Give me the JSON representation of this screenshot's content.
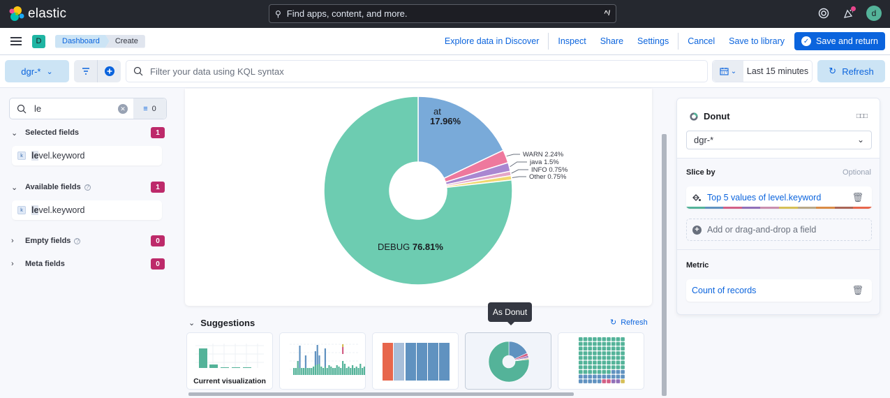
{
  "topbar": {
    "brand": "elastic",
    "search_placeholder": "Find apps, content, and more.",
    "search_shortcut": "^/",
    "avatar_initial": "d",
    "icons": [
      "help-icon",
      "news-icon",
      "user-avatar"
    ]
  },
  "header": {
    "space_initial": "D",
    "breadcrumbs": [
      "Dashboard",
      "Create"
    ],
    "links": [
      "Explore data in Discover",
      "Inspect",
      "Share",
      "Settings",
      "Cancel",
      "Save to library"
    ],
    "primary_button": "Save and return"
  },
  "query_bar": {
    "data_view": "dgr-*",
    "kql_placeholder": "Filter your data using KQL syntax",
    "time_range": "Last 15 minutes",
    "refresh_label": "Refresh"
  },
  "field_list": {
    "search_value": "le",
    "filter_count": "0",
    "sections": [
      {
        "label": "Selected fields",
        "count": "1",
        "expanded": true,
        "help": false,
        "fields": [
          {
            "type": "k",
            "match": "le",
            "rest": "vel.keyword"
          }
        ]
      },
      {
        "label": "Available fields",
        "count": "1",
        "expanded": true,
        "help": true,
        "fields": [
          {
            "type": "k",
            "match": "le",
            "rest": "vel.keyword"
          }
        ]
      },
      {
        "label": "Empty fields",
        "count": "0",
        "expanded": false,
        "help": true,
        "fields": []
      },
      {
        "label": "Meta fields",
        "count": "0",
        "expanded": false,
        "help": false,
        "fields": []
      }
    ]
  },
  "chart_data": {
    "type": "pie",
    "donut": true,
    "title": "",
    "slices": [
      {
        "label": "at",
        "value": 17.96,
        "color": "#79aad9"
      },
      {
        "label": "WARN",
        "value": 2.24,
        "color": "#ee789d"
      },
      {
        "label": "java",
        "value": 1.5,
        "color": "#a987d1"
      },
      {
        "label": "INFO",
        "value": 0.75,
        "color": "#e4a6c7"
      },
      {
        "label": "Other",
        "value": 0.75,
        "color": "#f1d86f"
      },
      {
        "label": "DEBUG",
        "value": 76.81,
        "color": "#6dccb1"
      }
    ],
    "labels": {
      "at": "17.96%",
      "WARN": "2.24%",
      "java": "1.5%",
      "INFO": "0.75%",
      "Other": "0.75%",
      "DEBUG": "76.81%"
    }
  },
  "suggestions": {
    "title": "Suggestions",
    "refresh_label": "Refresh",
    "tooltip": "As Donut",
    "cards": [
      {
        "name": "current-visualization",
        "caption": "Current visualization"
      },
      {
        "name": "stacked-bar",
        "caption": ""
      },
      {
        "name": "treemap",
        "caption": ""
      },
      {
        "name": "donut",
        "caption": ""
      },
      {
        "name": "waffle",
        "caption": ""
      }
    ]
  },
  "config_panel": {
    "chart_type": "Donut",
    "data_view": "dgr-*",
    "slice_by_label": "Slice by",
    "slice_by_optional": "Optional",
    "slice_by_value": "Top 5 values of level.keyword",
    "add_field": "Add or drag-and-drop a field",
    "metric_label": "Metric",
    "metric_value": "Count of records",
    "palette": [
      "#54b399",
      "#6092c0",
      "#d36086",
      "#9170b8",
      "#ca8eae",
      "#d6bf57",
      "#b9a888",
      "#da8b45",
      "#aa6556",
      "#e7664c"
    ]
  }
}
